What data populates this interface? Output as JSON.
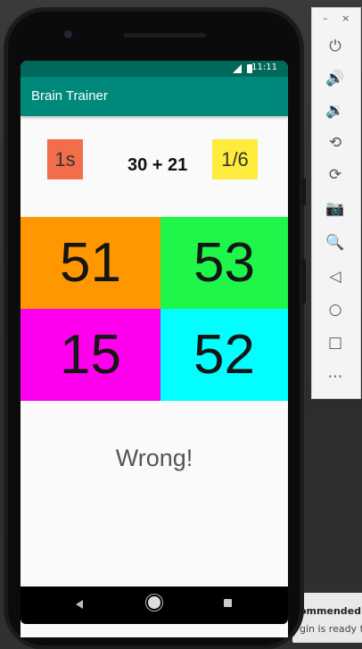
{
  "app": {
    "title": "Brain Trainer",
    "status_time": "11:11"
  },
  "game": {
    "timer": "1s",
    "question": "30 + 21",
    "score": "1/6",
    "answers": [
      "51",
      "53",
      "15",
      "52"
    ],
    "result": "Wrong!"
  },
  "notification": {
    "line1": "ommended",
    "line2": "gin is ready to"
  },
  "emulator_toolbar": {
    "minimize": "–",
    "close": "×",
    "tools": [
      {
        "name": "power-icon",
        "glyph": "⏻"
      },
      {
        "name": "volume-up-icon",
        "glyph": "🔊"
      },
      {
        "name": "volume-down-icon",
        "glyph": "🔉"
      },
      {
        "name": "rotate-left-icon",
        "glyph": "⟲"
      },
      {
        "name": "rotate-right-icon",
        "glyph": "⟳"
      },
      {
        "name": "camera-icon",
        "glyph": "📷"
      },
      {
        "name": "zoom-icon",
        "glyph": "🔍"
      },
      {
        "name": "back-icon",
        "glyph": "◁"
      },
      {
        "name": "home-icon",
        "glyph": "○"
      },
      {
        "name": "overview-icon",
        "glyph": "□"
      },
      {
        "name": "more-icon",
        "glyph": "⋯"
      }
    ]
  },
  "colors": {
    "status_bar": "#00695c",
    "app_bar": "#00897b",
    "timer_bg": "#f26d4a",
    "score_bg": "#ffeb3b",
    "answer_1": "#ff9800",
    "answer_2": "#1ef64a",
    "answer_3": "#ff00ee",
    "answer_4": "#00ffff"
  }
}
